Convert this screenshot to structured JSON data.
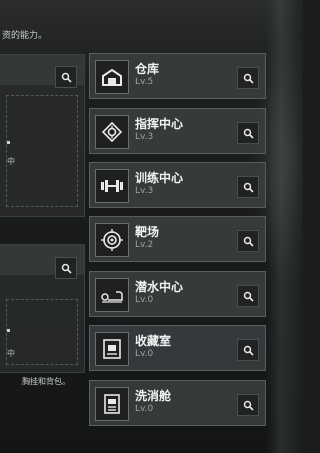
{
  "intro_text": "资的能力。",
  "left_panels": [
    {
      "mid_label": "中"
    },
    {
      "mid_label": "中"
    }
  ],
  "bottom_text": "胸挂和背包。",
  "facilities": [
    {
      "name": "仓库",
      "level": "Lv.5",
      "icon": "warehouse-icon"
    },
    {
      "name": "指挥中心",
      "level": "Lv.3",
      "icon": "command-center-icon"
    },
    {
      "name": "训练中心",
      "level": "Lv.3",
      "icon": "dumbbell-icon"
    },
    {
      "name": "靶场",
      "level": "Lv.2",
      "icon": "target-icon"
    },
    {
      "name": "潜水中心",
      "level": "Lv.0",
      "icon": "diving-icon"
    },
    {
      "name": "收藏室",
      "level": "Lv.0",
      "icon": "collection-icon"
    },
    {
      "name": "洗消舱",
      "level": "Lv.0",
      "icon": "decontamination-icon"
    }
  ],
  "colors": {
    "panel": "#3a3d3e",
    "accent": "#f1f3f3",
    "level": "#9ea2a3"
  }
}
